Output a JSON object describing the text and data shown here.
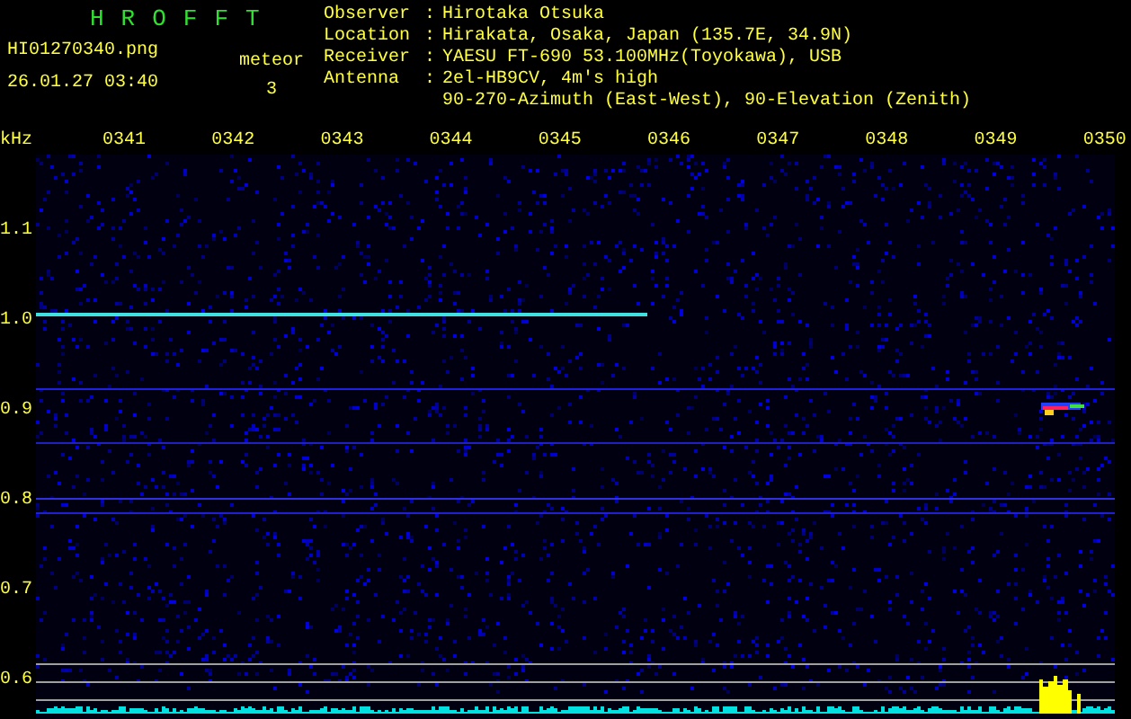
{
  "app_title": "HROFFT",
  "file": {
    "name": "HI01270340.png",
    "datetime": "26.01.27 03:40"
  },
  "meteor": {
    "label": "meteor",
    "count": "3"
  },
  "info": [
    {
      "label": "Observer",
      "separator": ":",
      "lines": [
        "Hirotaka Otsuka"
      ]
    },
    {
      "label": "Location",
      "separator": ":",
      "lines": [
        "Hirakata, Osaka, Japan (135.7E, 34.9N)"
      ]
    },
    {
      "label": "Receiver",
      "separator": ":",
      "lines": [
        "YAESU FT-690 53.100MHz(Toyokawa), USB"
      ]
    },
    {
      "label": "Antenna",
      "separator": ":",
      "lines": [
        "2el-HB9CV, 4m's high",
        "90-270-Azimuth (East-West), 90-Elevation (Zenith)"
      ]
    }
  ],
  "plot": {
    "y_unit": "kHz",
    "y_labels": [
      "1.1",
      "1.0",
      "0.9",
      "0.8",
      "0.7",
      "0.6"
    ],
    "time_labels": [
      "0341",
      "0342",
      "0343",
      "0344",
      "0345",
      "0346",
      "0347",
      "0348",
      "0349",
      "0350"
    ]
  }
}
